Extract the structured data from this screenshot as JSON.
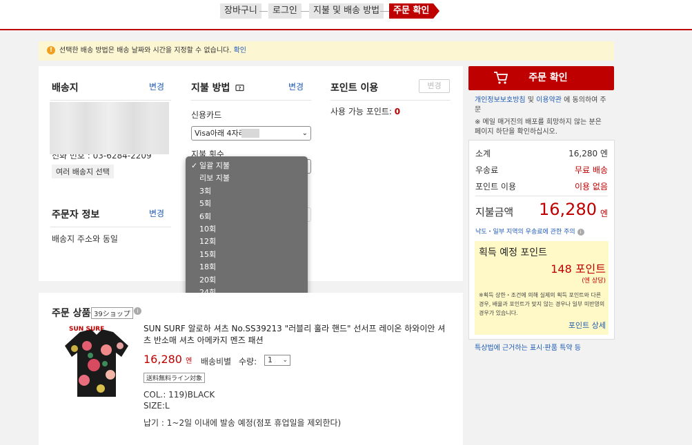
{
  "steps": [
    "장바구니",
    "로그인",
    "지불 및 배송 방법",
    "주문 확인"
  ],
  "notice": {
    "text": "선택한 배송 방법은 배송 날짜와 시간을 지정할 수 없습니다.",
    "link": "확인"
  },
  "shipping": {
    "title": "배송지",
    "change": "변경",
    "phone": "전화 번호 : 03-6284-2209",
    "multi_button": "여러 배송지 선택"
  },
  "payment": {
    "title": "지불 방법",
    "help_icon": "question-card-icon",
    "change": "변경",
    "method_label": "신용카드",
    "card_select": "Visa아래 4자리",
    "installment_label": "지불 횟수"
  },
  "points": {
    "title": "포인트 이용",
    "change": "변경",
    "available_label": "사용 가능 포인트:",
    "available_value": "0"
  },
  "orderer": {
    "title": "주문자 정보",
    "change": "변경",
    "text": "배송지 주소와 동일"
  },
  "installment_options": {
    "selected": "일괄 지불",
    "items": [
      "일괄 지불",
      "리보 지불",
      "3회",
      "5회",
      "6회",
      "10회",
      "12회",
      "15회",
      "18회",
      "20회",
      "24회"
    ]
  },
  "product": {
    "section_title": "주문 상품",
    "shop_badge": "39ショップ",
    "name": "SUN SURF 알로하 셔츠 No.SS39213 \"러블리 훌라 핸드\" 선서프 레이온 하와이안 셔츠 반소매 셔츠 아메카지 멘즈 패션",
    "price": "16,280",
    "price_unit": "엔",
    "shipping_type": "배송비별",
    "qty_label": "수량:",
    "qty_value": "1",
    "tag": "送料無料ライン対象",
    "color": "COL.: 119)BLACK",
    "size": "SIZE:L",
    "delivery": "납기 : 1~2일 이내에 발송 예정(점포 휴업일을 제외한다)",
    "image_label": "SUN SURF"
  },
  "sidebar": {
    "order_button": "주문 확인",
    "agree_link1": "개인정보보호방침",
    "agree_and": " 및 ",
    "agree_link2": "이용약관",
    "agree_rest": " 에 동의하여 주문",
    "mail_note": "※ 메일 매거진의 배포를 희망하지 않는 분은 페이지 하단을 확인하십시오.",
    "subtotal_label": "소계",
    "subtotal_value": "16,280 엔",
    "shipping_label": "우송료",
    "shipping_value": "무료 배송",
    "points_label": "포인트 이용",
    "points_value": "이용 없음",
    "total_label": "지불금액",
    "total_value": "16,280",
    "total_unit": "엔",
    "remote_note": "낙도・일부 지역의 우송료에 관한 주의",
    "earn_title": "획득 예정 포인트",
    "earn_value": "148 포인트",
    "earn_sub": "(엔 상당)",
    "earn_note": "※획득 상한・조건에 의해 실제의 획득 포인트와 다른 경우, 배율과 포인트가 맞지 않는 경우나 일부 미반영의 경우가 있습니다.",
    "earn_link": "포인트 상세",
    "law_link": "특상법에 근거하는 표시·판품 특약 등"
  },
  "colors": {
    "accent": "#bf0000",
    "link": "#1e5ab4",
    "highlight": "#fef9c7"
  }
}
